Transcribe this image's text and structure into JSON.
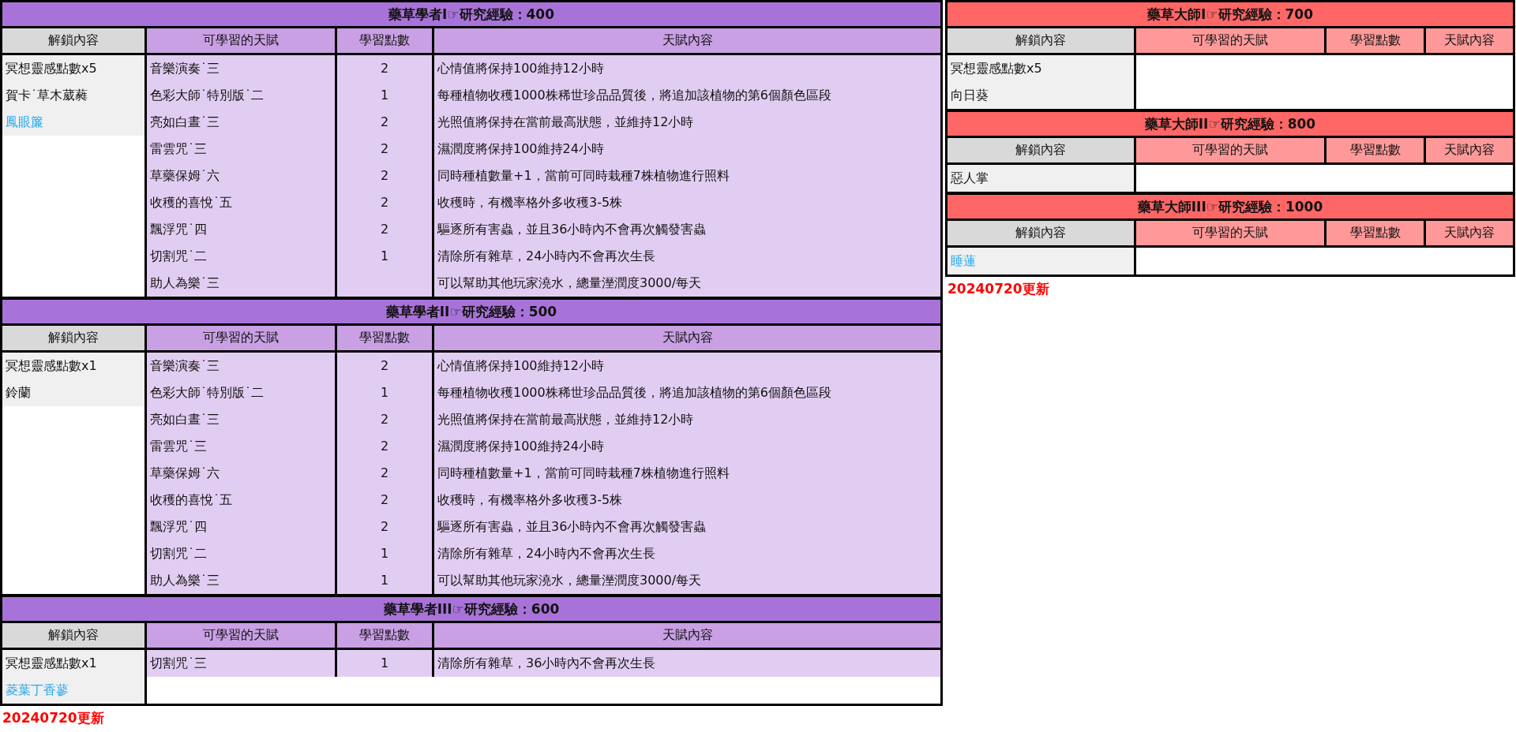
{
  "columns": [
    {
      "kind": "scholar",
      "tables": [
        {
          "title": "藥草學者I☞研究經驗：400",
          "headers": [
            "解鎖內容",
            "可學習的天賦",
            "學習點數",
            "天賦內容"
          ],
          "unlocks": [
            {
              "text": "冥想靈感點數x5",
              "kind": "plain"
            },
            {
              "text": "賀卡˙草木葳蕤",
              "kind": "plain"
            },
            {
              "text": "鳳眼簾",
              "kind": "link"
            }
          ],
          "talents": [
            {
              "name": "音樂演奏˙三",
              "points": "2",
              "effect": "心情值將保持100維持12小時"
            },
            {
              "name": "色彩大師˙特別版˙二",
              "points": "1",
              "effect": "每種植物收穫1000株稀世珍品品質後，將追加該植物的第6個顏色區段"
            },
            {
              "name": "亮如白晝˙三",
              "points": "2",
              "effect": "光照值將保持在當前最高狀態，並維持12小時"
            },
            {
              "name": "雷雲咒˙三",
              "points": "2",
              "effect": "濕潤度將保持100維持24小時"
            },
            {
              "name": "草藥保姆˙六",
              "points": "2",
              "effect": "同時種植數量+1，當前可同時栽種7株植物進行照料"
            },
            {
              "name": "收穫的喜悅˙五",
              "points": "2",
              "effect": "收穫時，有機率格外多收穫3-5株"
            },
            {
              "name": "飄浮咒˙四",
              "points": "2",
              "effect": "驅逐所有害蟲，並且36小時內不會再次觸發害蟲"
            },
            {
              "name": "切割咒˙二",
              "points": "1",
              "effect": "清除所有雜草，24小時內不會再次生長"
            },
            {
              "name": "助人為樂˙三",
              "effect": "可以幫助其他玩家澆水，總量溼潤度3000/每天"
            }
          ]
        },
        {
          "title": "藥草學者II☞研究經驗：500",
          "headers": [
            "解鎖內容",
            "可學習的天賦",
            "學習點數",
            "天賦內容"
          ],
          "unlocks": [
            {
              "text": "冥想靈感點數x1",
              "kind": "plain"
            },
            {
              "text": "鈴蘭",
              "kind": "plain"
            }
          ],
          "talents": [
            {
              "name": "音樂演奏˙三",
              "points": "2",
              "effect": "心情值將保持100維持12小時"
            },
            {
              "name": "色彩大師˙特別版˙二",
              "points": "1",
              "effect": "每種植物收穫1000株稀世珍品品質後，將追加該植物的第6個顏色區段"
            },
            {
              "name": "亮如白晝˙三",
              "points": "2",
              "effect": "光照值將保持在當前最高狀態，並維持12小時"
            },
            {
              "name": "雷雲咒˙三",
              "points": "2",
              "effect": "濕潤度將保持100維持24小時"
            },
            {
              "name": "草藥保姆˙六",
              "points": "2",
              "effect": "同時種植數量+1，當前可同時栽種7株植物進行照料"
            },
            {
              "name": "收穫的喜悅˙五",
              "points": "2",
              "effect": "收穫時，有機率格外多收穫3-5株"
            },
            {
              "name": "飄浮咒˙四",
              "points": "2",
              "effect": "驅逐所有害蟲，並且36小時內不會再次觸發害蟲"
            },
            {
              "name": "切割咒˙二",
              "points": "1",
              "effect": "清除所有雜草，24小時內不會再次生長"
            },
            {
              "name": "助人為樂˙三",
              "points": "1",
              "effect": "可以幫助其他玩家澆水，總量溼潤度3000/每天"
            }
          ]
        },
        {
          "title": "藥草學者III☞研究經驗：600",
          "headers": [
            "解鎖內容",
            "可學習的天賦",
            "學習點數",
            "天賦內容"
          ],
          "unlocks": [
            {
              "text": "冥想靈感點數x1",
              "kind": "plain"
            },
            {
              "text": "菱葉丁香蓼",
              "kind": "link"
            }
          ],
          "talents": [
            {
              "name": "切割咒˙三",
              "points": "1",
              "effect": "清除所有雜草，36小時內不會再次生長"
            }
          ]
        }
      ],
      "note": "20240720更新"
    },
    {
      "kind": "master",
      "tables": [
        {
          "title": "藥草大師I☞研究經驗：700",
          "headers": [
            "解鎖內容",
            "可學習的天賦",
            "學習點數",
            "天賦內容"
          ],
          "unlocks": [
            {
              "text": "冥想靈感點數x5",
              "kind": "plain"
            },
            {
              "text": "向日葵",
              "kind": "plain"
            }
          ]
        },
        {
          "title": "藥草大師II☞研究經驗：800",
          "headers": [
            "解鎖內容",
            "可學習的天賦",
            "學習點數",
            "天賦內容"
          ],
          "unlocks": [
            {
              "text": "惡人掌",
              "kind": "plain"
            }
          ]
        },
        {
          "title": "藥草大師III☞研究經驗：1000",
          "headers": [
            "解鎖內容",
            "可學習的天賦",
            "學習點數",
            "天賦內容"
          ],
          "unlocks": [
            {
              "text": "睡蓮",
              "kind": "link"
            }
          ]
        }
      ],
      "note": "20240720更新"
    }
  ]
}
